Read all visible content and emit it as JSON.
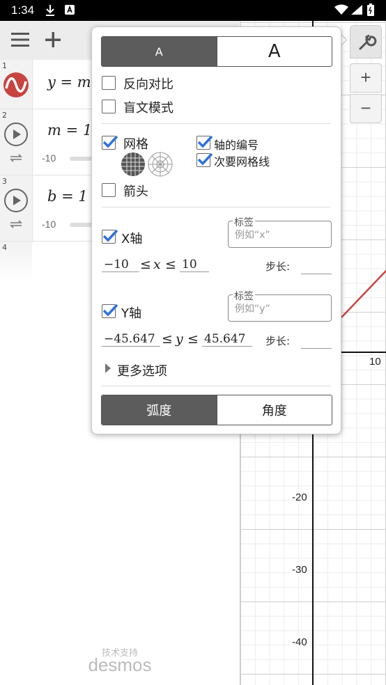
{
  "status_bar": {
    "time": "1:34"
  },
  "graph": {
    "tick_labels": {
      "x_10": "10",
      "y_neg20": "-20",
      "y_neg30": "-30",
      "y_neg40": "-40"
    },
    "line_color": "#c74440"
  },
  "zoom": {
    "in": "+",
    "out": "−"
  },
  "expressions": [
    {
      "index": "1",
      "formula": "y = m"
    },
    {
      "index": "2",
      "formula": "m = 1",
      "slider_min": "-10"
    },
    {
      "index": "3",
      "formula": "b = 1",
      "slider_min": "-10"
    },
    {
      "index": "4"
    }
  ],
  "powered_by": {
    "caption": "技术支持",
    "brand": "desmos"
  },
  "settings": {
    "text_size": {
      "small": "A",
      "large": "A"
    },
    "reverse_contrast": "反向对比",
    "braille_mode": "盲文模式",
    "grid": "网格",
    "axis_numbers": "轴的编号",
    "minor_gridlines": "次要网格线",
    "arrows": "箭头",
    "x_axis": {
      "label": "X轴",
      "field_label": "标签",
      "placeholder": "例如“x”",
      "min": "−10",
      "var": "x",
      "max": "10",
      "step_label": "步长:"
    },
    "y_axis": {
      "label": "Y轴",
      "field_label": "标签",
      "placeholder": "例如“y”",
      "min": "−45.647",
      "var": "y",
      "max": "45.647",
      "step_label": "步长:"
    },
    "more_options": "更多选项",
    "angle_mode": {
      "radians": "弧度",
      "degrees": "角度"
    }
  }
}
